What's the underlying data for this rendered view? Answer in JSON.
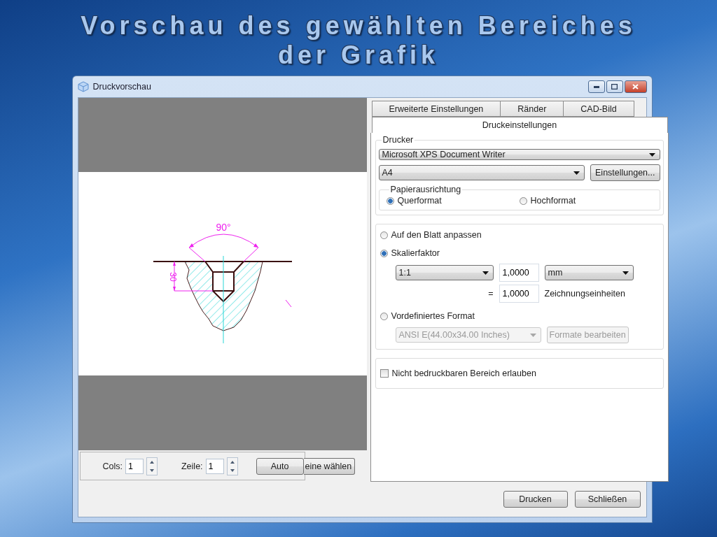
{
  "slide": {
    "title_lines": [
      "Vorschau des gewählten Bereiches",
      "der Grafik"
    ]
  },
  "window": {
    "title": "Druckvorschau"
  },
  "preview": {
    "dimension_labels": [
      "90°",
      "30"
    ],
    "grid": {
      "cols_label": "Cols:",
      "cols_value": "1",
      "rows_label": "Zeile:",
      "rows_value": "1",
      "auto_button": "Auto",
      "partial_button": "eine wählen"
    }
  },
  "tabs": [
    {
      "label": "Erweiterte Einstellungen",
      "selected": false
    },
    {
      "label": "Ränder",
      "selected": false
    },
    {
      "label": "CAD-Bild",
      "selected": false
    },
    {
      "label": "Druckeinstellungen",
      "selected": true
    }
  ],
  "printer": {
    "legend": "Drucker",
    "printer": "Microsoft XPS Document Writer",
    "paper": "A4",
    "settings_button": "Einstellungen..."
  },
  "orientation": {
    "legend": "Papierausrichtung",
    "options": [
      {
        "label": "Querformat",
        "selected": true
      },
      {
        "label": "Hochformat",
        "selected": false
      }
    ]
  },
  "scale": {
    "options": [
      {
        "label": "Auf den Blatt anpassen",
        "selected": false
      },
      {
        "label": "Skalierfaktor",
        "selected": true
      },
      {
        "label": "Vordefiniertes Format",
        "selected": false
      }
    ],
    "ratio": "1:1",
    "paper_units_value": "1,0000",
    "unit": "mm",
    "equals": "=",
    "drawing_units_value": "1,0000",
    "drawing_units_label": "Zeichnungseinheiten",
    "format": "ANSI E(44.00x34.00 Inches)",
    "format_disabled": true,
    "edit_formats_button": "Formate bearbeiten"
  },
  "nonprintable": {
    "label": "Nicht bedruckbaren Bereich erlauben",
    "checked": false
  },
  "buttons": [
    "Drucken",
    "Schließen"
  ]
}
